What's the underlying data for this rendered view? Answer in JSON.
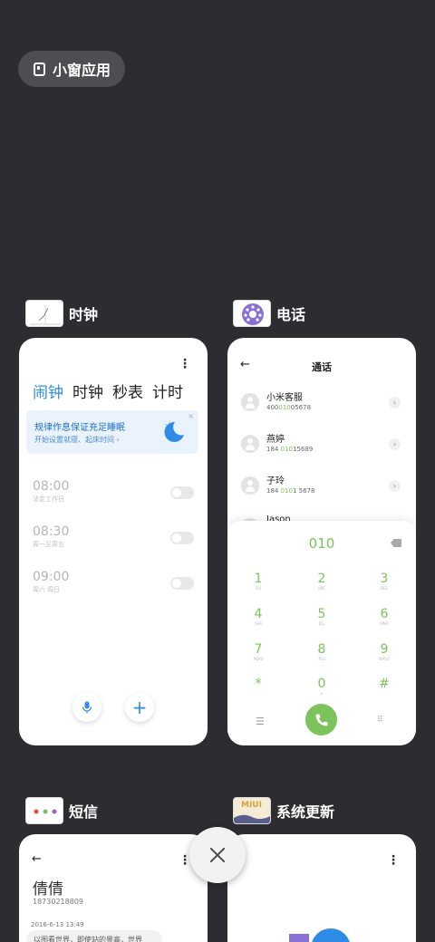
{
  "small_window": {
    "label": "小窗应用",
    "icon": "small-window-icon"
  },
  "apps": {
    "clock": {
      "name": "时钟",
      "tabs": [
        "闹钟",
        "时钟",
        "秒表",
        "计时"
      ],
      "banner": {
        "title": "规律作息保证充足睡眠",
        "subtitle": "开始设置就寝、起床时间"
      },
      "alarms": [
        {
          "time": "08:00",
          "repeat": "法定工作日",
          "enabled": false
        },
        {
          "time": "08:30",
          "repeat": "周一至周五",
          "enabled": false
        },
        {
          "time": "09:00",
          "repeat": "周六 周日",
          "enabled": false
        }
      ],
      "accent": "#2e8be6"
    },
    "phone": {
      "name": "电话",
      "title": "通话",
      "contacts": [
        {
          "name": "小米客服",
          "num_pre": "400",
          "num_hl": "010",
          "num_post": "05678"
        },
        {
          "name": "燕婷",
          "num_pre": "184 ",
          "num_hl": "010",
          "num_post": "15689"
        },
        {
          "name": "子玲",
          "num_pre": "184 ",
          "num_hl": "010",
          "num_post": "1 5678"
        },
        {
          "name": "Jason",
          "num_pre": "",
          "num_hl": "",
          "num_post": ""
        }
      ],
      "dial_input": "010",
      "keys": [
        {
          "d": "1",
          "l": "GU"
        },
        {
          "d": "2",
          "l": "ABC"
        },
        {
          "d": "3",
          "l": "DEF"
        },
        {
          "d": "4",
          "l": "GHI"
        },
        {
          "d": "5",
          "l": "JKL"
        },
        {
          "d": "6",
          "l": "MNO"
        },
        {
          "d": "7",
          "l": "PQRS"
        },
        {
          "d": "8",
          "l": "TUV"
        },
        {
          "d": "9",
          "l": "WXYZ"
        },
        {
          "d": "*",
          "l": ","
        },
        {
          "d": "0",
          "l": "+"
        },
        {
          "d": "#",
          "l": ""
        }
      ],
      "accent": "#7cc35b"
    },
    "sms": {
      "name": "短信",
      "contact": "倩倩",
      "number": "18730218809",
      "time": "2016-6-13 13:49",
      "message": "以图看世界，即使站的景高，世界"
    },
    "update": {
      "name": "系统更新",
      "logo_text": "MIUI"
    }
  }
}
